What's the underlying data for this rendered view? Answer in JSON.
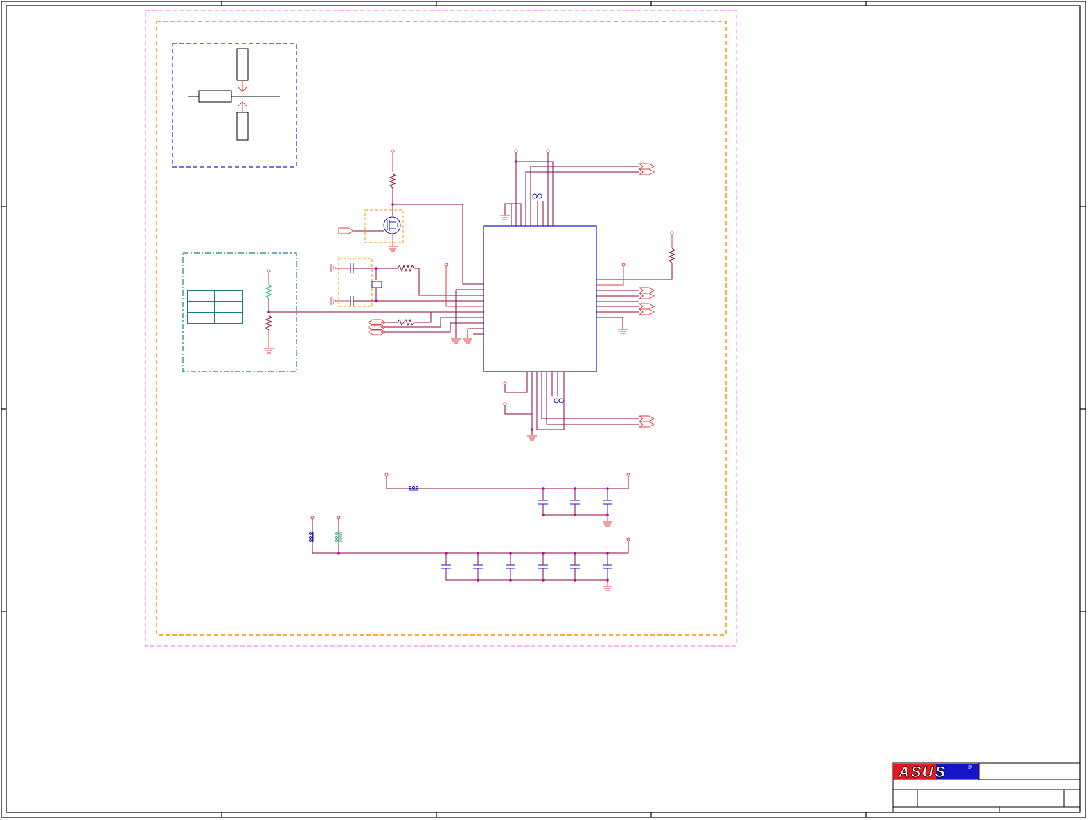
{
  "sheet": {
    "logo": "ASUS",
    "logo_mark": "®",
    "colors": {
      "wire": "#8b0a3c",
      "power": "#e03c3c",
      "part": "#1414c8",
      "group_border": "#ff8c00",
      "outer_border": "#ff80ff",
      "keepout_border": "#2020d0",
      "teal": "#14827a",
      "green_resistor": "#22b573",
      "frame": "#000000",
      "logo_red": "#e8141e",
      "logo_blue": "#1414c8"
    }
  },
  "icons": {
    "ground": "ground-icon",
    "power_rail": "power-pin-icon",
    "offpage_connector": "offpage-connector-icon",
    "resistor": "resistor-icon",
    "capacitor": "capacitor-icon",
    "crystal": "crystal-icon",
    "mosfet": "mosfet-icon",
    "ferrite_bead": "ferrite-bead-icon",
    "chip": "ic-chip-icon"
  }
}
